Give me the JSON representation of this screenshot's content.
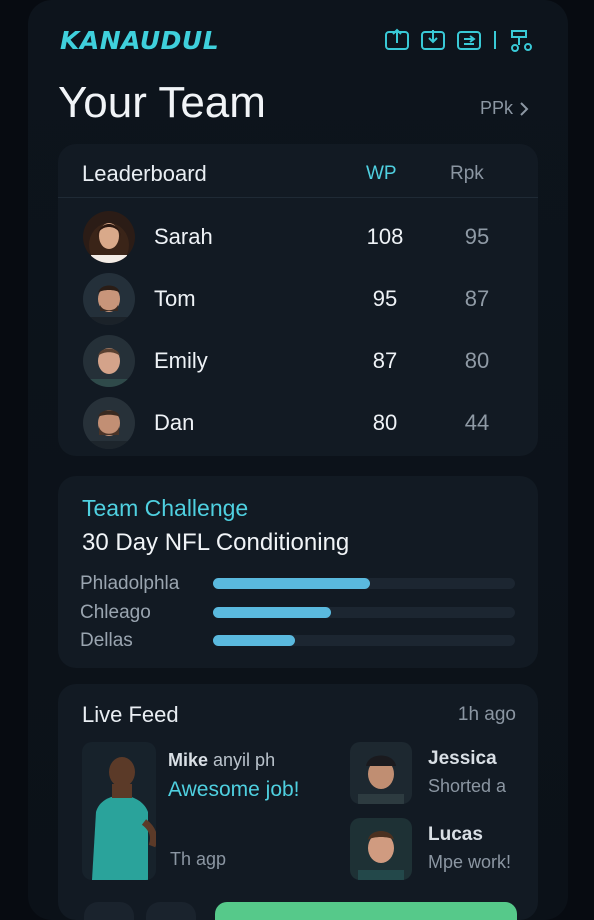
{
  "app": {
    "brand": "KANAUDUL",
    "title": "Your Team",
    "ppk_link": "PPk"
  },
  "top_icons": [
    "upload-icon",
    "download-icon",
    "sync-icon",
    "settings-icon"
  ],
  "leaderboard": {
    "title": "Leaderboard",
    "columns": {
      "wp": "WP",
      "rpk": "Rpk"
    },
    "rows": [
      {
        "name": "Sarah",
        "wp": "108",
        "rpk": "95"
      },
      {
        "name": "Tom",
        "wp": "95",
        "rpk": "87"
      },
      {
        "name": "Emily",
        "wp": "87",
        "rpk": "80"
      },
      {
        "name": "Dan",
        "wp": "80",
        "rpk": "44"
      }
    ]
  },
  "challenge": {
    "kicker": "Team Challenge",
    "title": "30 Day NFL Conditioning",
    "bars": [
      {
        "label": "Phladolphla",
        "progress": 0.52
      },
      {
        "label": "Chleago",
        "progress": 0.39
      },
      {
        "label": "Dellas",
        "progress": 0.27
      }
    ]
  },
  "feed": {
    "title": "Live Feed",
    "time": "1h ago",
    "main_post": {
      "name": "Mike",
      "suffix": " anyil ph",
      "text": "Awesome job!",
      "time": "Th agp"
    },
    "side_posts": [
      {
        "name": "Jessica",
        "text": "Shorted a"
      },
      {
        "name": "Lucas",
        "text": "Mpe work!"
      }
    ]
  },
  "colors": {
    "accent": "#4fd0e0",
    "bar": "#5ab9de",
    "primary": "#56c98a",
    "card": "#121a23"
  }
}
